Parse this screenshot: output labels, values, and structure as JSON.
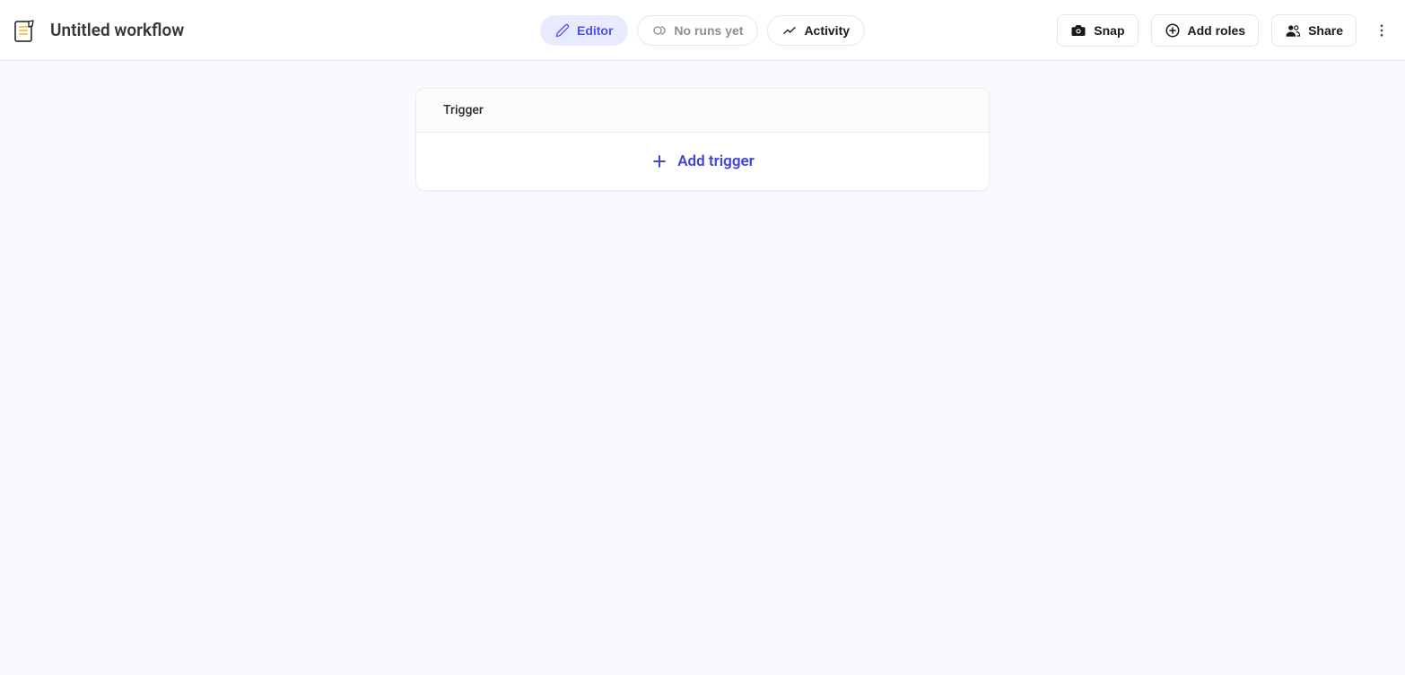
{
  "header": {
    "title": "Untitled workflow",
    "center_tabs": {
      "editor_label": "Editor",
      "no_runs_label": "No runs yet",
      "activity_label": "Activity"
    },
    "actions": {
      "snap_label": "Snap",
      "add_roles_label": "Add roles",
      "share_label": "Share"
    }
  },
  "canvas": {
    "trigger_card": {
      "header_label": "Trigger",
      "add_trigger_label": "Add trigger"
    }
  },
  "colors": {
    "accent": "#4145d6",
    "accent_bg": "#e8ebff",
    "border": "#e5e7eb",
    "canvas_bg": "#f9fafd",
    "muted_text": "#8f8f8f"
  }
}
